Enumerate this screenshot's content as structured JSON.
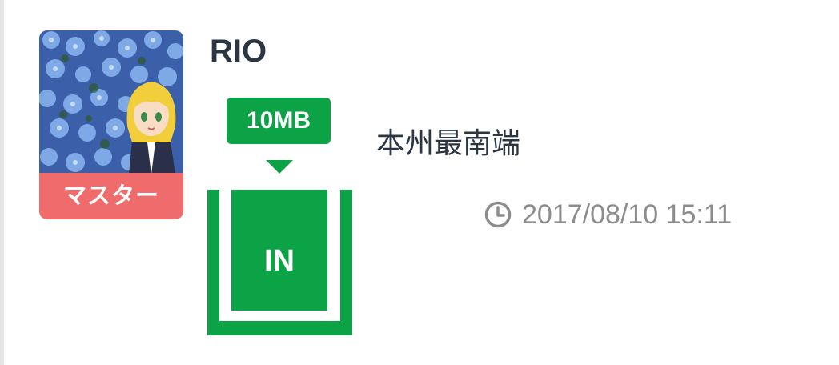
{
  "post": {
    "user_name": "RIO",
    "role_label": "マスター",
    "size_label": "10MB",
    "status_label": "IN",
    "message": "本州最南端",
    "timestamp": "2017/08/10 15:11"
  },
  "icons": {
    "avatar": "user-avatar-image",
    "clock": "clock-icon",
    "arrow": "triangle-down-icon"
  },
  "colors": {
    "accent_green": "#0ca347",
    "badge_red": "#f06b6b",
    "text_dark": "#2b3642",
    "text_gray": "#8c8c8c"
  }
}
